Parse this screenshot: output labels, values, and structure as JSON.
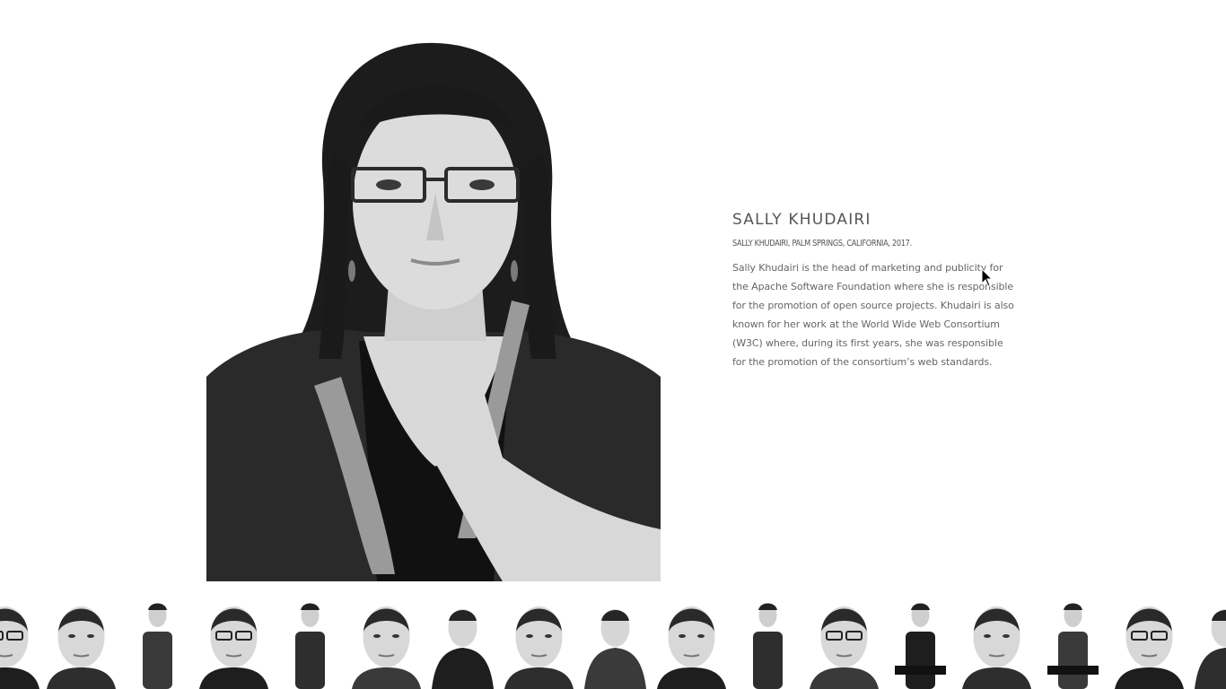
{
  "person": {
    "name": "SALLY KHUDAIRI",
    "caption": "SALLY KHUDAIRI, PALM SPRINGS, CALIFORNIA, 2017.",
    "bio": "Sally Khudairi is the head of marketing and publicity for the Apache Software Foundation where she is responsible for the promotion of open source projects. Khudairi is also known for her work at the World Wide Web Consortium (W3C) where, during its first years, she was responsible for the promotion of the consortium’s web standards."
  },
  "thumbnails": [
    {
      "style": "headshot-glasses"
    },
    {
      "style": "headshot"
    },
    {
      "style": "full-body"
    },
    {
      "style": "headshot-glasses"
    },
    {
      "style": "full-body"
    },
    {
      "style": "headshot"
    },
    {
      "style": "half-body"
    },
    {
      "style": "headshot"
    },
    {
      "style": "half-body"
    },
    {
      "style": "headshot"
    },
    {
      "style": "full-body"
    },
    {
      "style": "headshot-glasses"
    },
    {
      "style": "seated"
    },
    {
      "style": "headshot"
    },
    {
      "style": "seated"
    },
    {
      "style": "headshot-glasses"
    },
    {
      "style": "half-body"
    }
  ]
}
